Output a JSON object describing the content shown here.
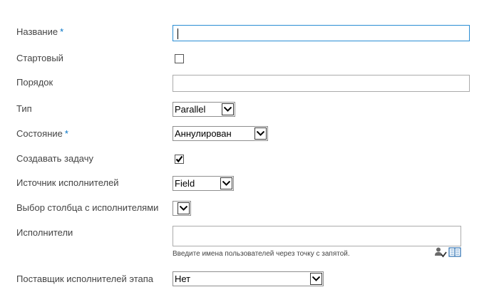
{
  "fields": {
    "name": {
      "label": "Название",
      "required_mark": "*",
      "value": ""
    },
    "start": {
      "label": "Стартовый",
      "checked": false
    },
    "order": {
      "label": "Порядок",
      "value": ""
    },
    "type": {
      "label": "Тип",
      "selected": "Parallel"
    },
    "state": {
      "label": "Состояние",
      "required_mark": "*",
      "selected": "Аннулирован"
    },
    "create_task": {
      "label": "Создавать задачу",
      "checked": true
    },
    "performers_source": {
      "label": "Источник исполнителей",
      "selected": "Field"
    },
    "performers_column": {
      "label": "Выбор столбца с исполнителями",
      "selected": ""
    },
    "performers": {
      "label": "Исполнители",
      "value": "",
      "hint": "Введите имена пользователей через точку с запятой."
    },
    "stage_provider": {
      "label": "Поставщик исполнителей этапа",
      "selected": "Нет"
    }
  },
  "icons": {
    "check_names": "check-names-icon",
    "browse": "address-book-icon"
  },
  "colors": {
    "required_mark": "#0072c6",
    "focus_border": "#2a8dd4"
  }
}
